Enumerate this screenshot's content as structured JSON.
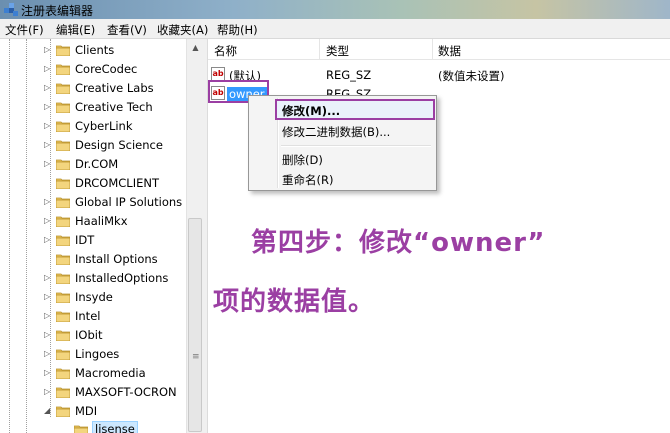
{
  "window": {
    "title": "注册表编辑器"
  },
  "menu": [
    "文件(F)",
    "编辑(E)",
    "查看(V)",
    "收藏夹(A)",
    "帮助(H)"
  ],
  "tree": {
    "items": [
      {
        "label": "Clients",
        "expander": "collapsed"
      },
      {
        "label": "CoreCodec",
        "expander": "collapsed"
      },
      {
        "label": "Creative Labs",
        "expander": "collapsed"
      },
      {
        "label": "Creative Tech",
        "expander": "collapsed"
      },
      {
        "label": "CyberLink",
        "expander": "collapsed"
      },
      {
        "label": "Design Science",
        "expander": "collapsed"
      },
      {
        "label": "Dr.COM",
        "expander": "collapsed"
      },
      {
        "label": "DRCOMCLIENT",
        "expander": "none"
      },
      {
        "label": "Global IP Solutions",
        "expander": "collapsed"
      },
      {
        "label": "HaaliMkx",
        "expander": "collapsed"
      },
      {
        "label": "IDT",
        "expander": "collapsed"
      },
      {
        "label": "Install Options",
        "expander": "none"
      },
      {
        "label": "InstalledOptions",
        "expander": "collapsed"
      },
      {
        "label": "Insyde",
        "expander": "collapsed"
      },
      {
        "label": "Intel",
        "expander": "collapsed"
      },
      {
        "label": "IObit",
        "expander": "collapsed"
      },
      {
        "label": "Lingoes",
        "expander": "collapsed"
      },
      {
        "label": "Macromedia",
        "expander": "collapsed"
      },
      {
        "label": "MAXSOFT-OCRON",
        "expander": "collapsed"
      },
      {
        "label": "MDI",
        "expander": "expanded"
      }
    ],
    "child": {
      "label": "lisense",
      "selected": true
    }
  },
  "columns": {
    "name": "名称",
    "type": "类型",
    "data": "数据"
  },
  "values": [
    {
      "name": "(默认)",
      "type": "REG_SZ",
      "data": "(数值未设置)",
      "icon": "string-value-icon"
    },
    {
      "name": "owner",
      "type": "REG_SZ",
      "data": "",
      "icon": "string-value-icon",
      "selected": true
    }
  ],
  "value_icon_glyph": "ab",
  "context_menu": {
    "items": [
      "修改(M)...",
      "修改二进制数据(B)...",
      "删除(D)",
      "重命名(R)"
    ]
  },
  "annotation": {
    "line1": "第四步：修改“owner”",
    "line2": "项的数据值。",
    "color": "#9b3fa3"
  },
  "colors": {
    "selection": "#3399ff",
    "highlight_border": "#9b3fa3",
    "folder": "#e8c15a"
  }
}
